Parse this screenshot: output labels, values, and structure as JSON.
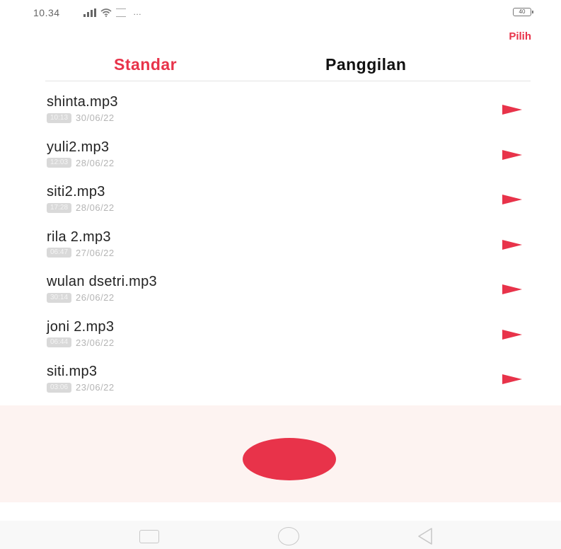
{
  "status_bar": {
    "time": "10.34",
    "misc": "…",
    "battery": "40"
  },
  "header": {
    "select_label": "Pilih"
  },
  "tabs": [
    {
      "label": "Standar",
      "active": true
    },
    {
      "label": "Panggilan",
      "active": false
    }
  ],
  "recordings": [
    {
      "name": "shinta.mp3",
      "duration": "10:13",
      "date": "30/06/22"
    },
    {
      "name": "yuli2.mp3",
      "duration": "12:03",
      "date": "28/06/22"
    },
    {
      "name": "siti2.mp3",
      "duration": "17:28",
      "date": "28/06/22"
    },
    {
      "name": "rila 2.mp3",
      "duration": "06:47",
      "date": "27/06/22"
    },
    {
      "name": "wulan dsetri.mp3",
      "duration": "30:14",
      "date": "26/06/22"
    },
    {
      "name": "joni 2.mp3",
      "duration": "06:44",
      "date": "23/06/22"
    },
    {
      "name": "siti.mp3",
      "duration": "03:06",
      "date": "23/06/22"
    }
  ],
  "colors": {
    "accent": "#e8334a",
    "record_panel_bg": "#fdf3f1",
    "text_primary": "#222222",
    "text_secondary": "#b5b5b5"
  },
  "icons": {
    "play": "play-icon",
    "record": "record-icon",
    "nav_recent": "recent-apps-icon",
    "nav_home": "home-icon",
    "nav_back": "back-icon"
  }
}
